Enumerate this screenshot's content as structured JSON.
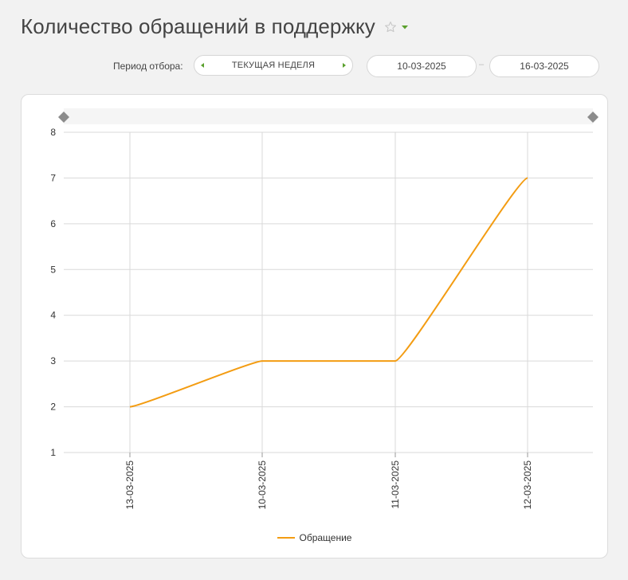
{
  "page": {
    "title": "Количество обращений в поддержку"
  },
  "filter": {
    "period_label": "Период отбора:",
    "period_value": "ТЕКУЩАЯ НЕДЕЛЯ",
    "date_from": "10-03-2025",
    "date_to": "16-03-2025",
    "date_separator": "–"
  },
  "colors": {
    "accent_green": "#5aa02c",
    "series_orange": "#f39c12",
    "grid": "#d9d9d9",
    "handle": "#8c8c8c"
  },
  "icons": {
    "favorite": "star-outline-icon",
    "menu": "caret-down-icon",
    "prev": "triangle-left-icon",
    "next": "triangle-right-icon"
  },
  "chart_data": {
    "type": "line",
    "categories": [
      "13-03-2025",
      "10-03-2025",
      "11-03-2025",
      "12-03-2025"
    ],
    "series": [
      {
        "name": "Обращение",
        "values": [
          2,
          3,
          3,
          7
        ],
        "color": "#f39c12"
      }
    ],
    "ylim": [
      1,
      8
    ],
    "yticks": [
      "1",
      "2",
      "3",
      "4",
      "5",
      "6",
      "7",
      "8"
    ],
    "grid": true,
    "legend_position": "bottom-center"
  }
}
